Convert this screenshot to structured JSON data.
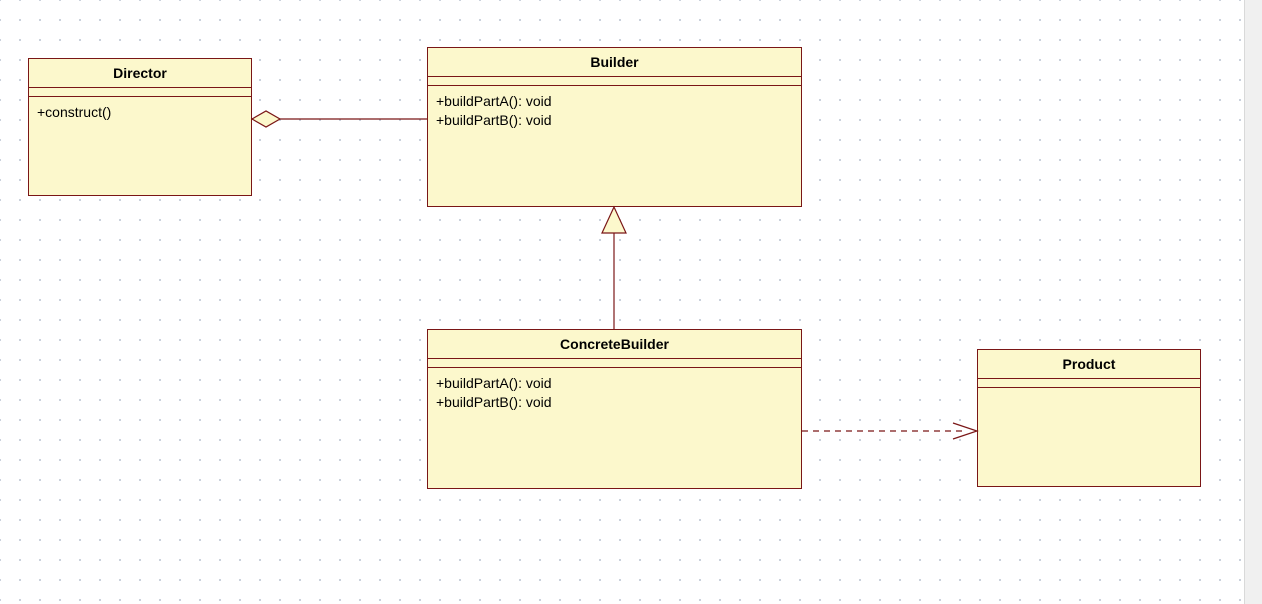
{
  "classes": {
    "director": {
      "name": "Director",
      "ops": [
        "+construct()"
      ]
    },
    "builder": {
      "name": "Builder",
      "ops": [
        "+buildPartA(): void",
        "+buildPartB(): void"
      ]
    },
    "concreteBuilder": {
      "name": "ConcreteBuilder",
      "ops": [
        "+buildPartA(): void",
        "+buildPartB(): void"
      ]
    },
    "product": {
      "name": "Product",
      "ops": []
    }
  },
  "relationships": [
    {
      "from": "Director",
      "to": "Builder",
      "type": "aggregation"
    },
    {
      "from": "ConcreteBuilder",
      "to": "Builder",
      "type": "generalization"
    },
    {
      "from": "ConcreteBuilder",
      "to": "Product",
      "type": "dependency"
    }
  ]
}
